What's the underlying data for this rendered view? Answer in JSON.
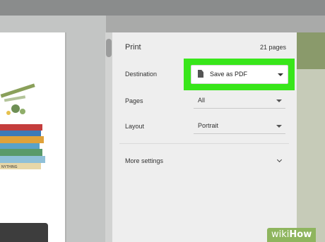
{
  "print_panel": {
    "title": "Print",
    "pages_count": "21 pages",
    "destination": {
      "label": "Destination",
      "value": "Save as PDF",
      "icon": "document-icon"
    },
    "pages": {
      "label": "Pages",
      "value": "All"
    },
    "layout": {
      "label": "Layout",
      "value": "Portrait"
    },
    "more_settings": {
      "label": "More settings",
      "icon": "chevron-down-icon"
    }
  },
  "preview": {
    "book_spine_text": "NYTHING"
  },
  "colors": {
    "highlight": "#38e61a",
    "panel_background": "#eeeeee",
    "watermark_background": "#8eb55e"
  },
  "watermark": {
    "light": "wiki",
    "bold": "How"
  }
}
